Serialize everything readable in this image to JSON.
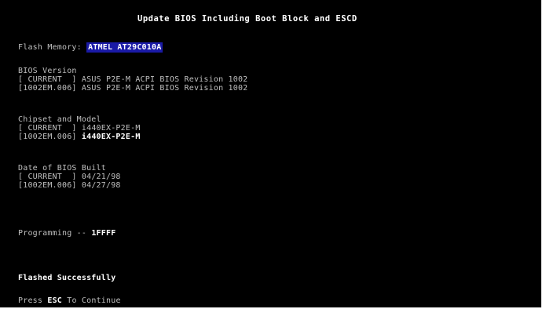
{
  "screen": {
    "title": "Update BIOS Including Boot Block and ESCD",
    "flash_memory": {
      "label": "Flash Memory:",
      "value": "ATMEL AT29C010A"
    },
    "bios_version": {
      "heading": "BIOS Version",
      "rows": [
        {
          "key": "[ CURRENT  ]",
          "value": "ASUS P2E-M ACPI BIOS Revision 1002"
        },
        {
          "key": "[1002EM.006]",
          "value": "ASUS P2E-M ACPI BIOS Revision 1002"
        }
      ]
    },
    "chipset_model": {
      "heading": "Chipset and Model",
      "rows": [
        {
          "key": "[ CURRENT  ]",
          "value": "i440EX-P2E-M"
        },
        {
          "key": "[1002EM.006]",
          "value": "i440EX-P2E-M"
        }
      ]
    },
    "date_built": {
      "heading": "Date of BIOS Built",
      "rows": [
        {
          "key": "[ CURRENT  ]",
          "value": "04/21/98"
        },
        {
          "key": "[1002EM.006]",
          "value": "04/27/98"
        }
      ]
    },
    "programming": {
      "label": "Programming --",
      "value": "1FFFF"
    },
    "status": "Flashed Successfully",
    "prompt": {
      "prefix": "Press",
      "key": "ESC",
      "suffix": "To Continue"
    }
  }
}
